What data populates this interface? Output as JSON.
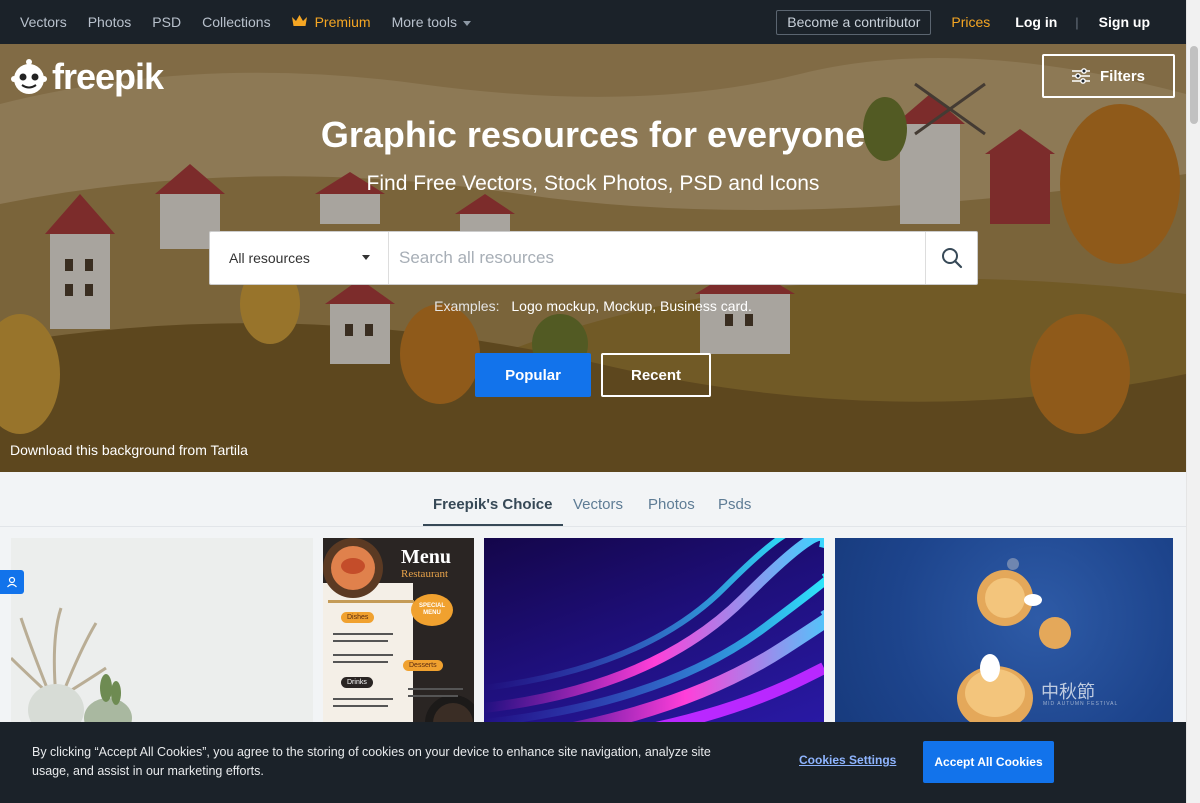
{
  "nav": {
    "items": [
      {
        "label": "Vectors"
      },
      {
        "label": "Photos"
      },
      {
        "label": "PSD"
      },
      {
        "label": "Collections"
      }
    ],
    "premium": "Premium",
    "more_tools": "More tools",
    "contributor": "Become a contributor",
    "prices": "Prices",
    "login": "Log in",
    "separator": "|",
    "signup": "Sign up"
  },
  "hero": {
    "logo": "freepik",
    "filters": "Filters",
    "title": "Graphic resources for everyone",
    "subtitle": "Find Free Vectors, Stock Photos, PSD and Icons",
    "search": {
      "selected_resource": "All resources",
      "placeholder": "Search all resources"
    },
    "examples_label": "Examples:",
    "examples": [
      "Logo mockup,",
      "Mockup,",
      "Business card."
    ],
    "popular": "Popular",
    "recent": "Recent",
    "credit": "Download this background from Tartila"
  },
  "tabs": [
    {
      "label": "Freepik's Choice",
      "active": true
    },
    {
      "label": "Vectors"
    },
    {
      "label": "Photos"
    },
    {
      "label": "Psds"
    }
  ],
  "cards": {
    "menu": {
      "title": "Menu",
      "subtitle": "Restaurant",
      "special": "SPECIAL MENU",
      "sections": [
        "Dishes",
        "Desserts",
        "Drinks"
      ]
    },
    "mooncake": {
      "chinese": "中秋節",
      "caption": "MID AUTUMN FESTIVAL"
    }
  },
  "cookie": {
    "text": "By clicking “Accept All Cookies”, you agree to the storing of cookies on your device to enhance site navigation, analyze site usage, and assist in our marketing efforts.",
    "settings": "Cookies Settings",
    "accept": "Accept All Cookies"
  },
  "colors": {
    "nav_bg": "#1b2229",
    "premium": "#f5a623",
    "accent_blue": "#1273eb",
    "tab_active": "#374957",
    "tab_inactive": "#5e7c95"
  }
}
